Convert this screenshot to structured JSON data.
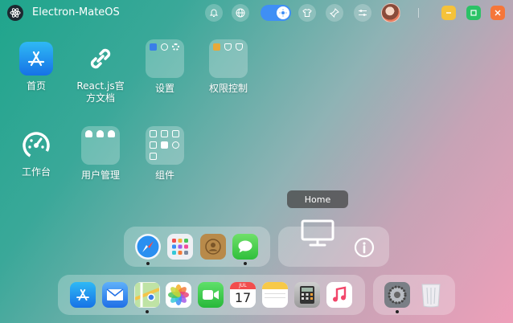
{
  "app": {
    "title": "Electron-MateOS"
  },
  "topbar": {
    "buttons": [
      "bell-icon",
      "globe-icon",
      "theme-toggle",
      "shirt-icon",
      "pin-icon",
      "sliders-icon"
    ],
    "window_controls": {
      "minimize_color": "#f5c23a",
      "maximize_color": "#2bc266",
      "close_color": "#f5763a"
    }
  },
  "desktop": {
    "items": [
      {
        "label": "首页",
        "icon": "app-store-icon"
      },
      {
        "label": "React.js官方文档",
        "icon": "link-icon"
      },
      {
        "label": "设置",
        "icon": "folder-icon"
      },
      {
        "label": "权限控制",
        "icon": "folder-icon"
      },
      {
        "label": "工作台",
        "icon": "dashboard-icon"
      },
      {
        "label": "用户管理",
        "icon": "folder-icon"
      },
      {
        "label": "组件",
        "icon": "folder-icon"
      }
    ]
  },
  "tooltip": {
    "text": "Home"
  },
  "dock_top": {
    "apps": [
      "safari-icon",
      "launchpad-icon",
      "contacts-icon",
      "messages-icon"
    ]
  },
  "dock_preview": {
    "items": [
      "monitor-icon",
      "info-icon"
    ]
  },
  "dock_bottom": {
    "apps": [
      "app-store-icon",
      "mail-icon",
      "maps-icon",
      "photos-icon",
      "facetime-icon",
      "calendar-icon",
      "notes-icon",
      "calculator-icon",
      "music-icon"
    ],
    "calendar": {
      "month": "JUL",
      "day": "17"
    }
  },
  "dock_system": {
    "apps": [
      "system-preferences-icon",
      "trash-icon"
    ]
  },
  "colors": {
    "accent": "#3f8ff5"
  }
}
